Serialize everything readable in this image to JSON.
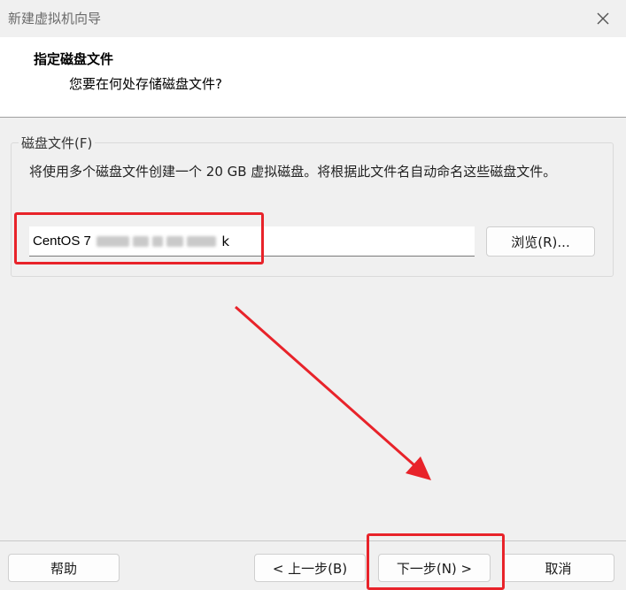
{
  "window": {
    "title": "新建虚拟机向导"
  },
  "header": {
    "title": "指定磁盘文件",
    "subtitle": "您要在何处存储磁盘文件?"
  },
  "disk_group": {
    "label": "磁盘文件(F)",
    "description": "将使用多个磁盘文件创建一个 20 GB 虚拟磁盘。将根据此文件名自动命名这些磁盘文件。",
    "file_name_value": "CentOS 7",
    "file_name_suffix_visible": "k",
    "browse_label": "浏览(R)..."
  },
  "footer": {
    "help_label": "帮助",
    "back_label": "< 上一步(B)",
    "next_label": "下一步(N) >",
    "cancel_label": "取消"
  },
  "annotations": {
    "highlight_color": "#e8232a"
  }
}
